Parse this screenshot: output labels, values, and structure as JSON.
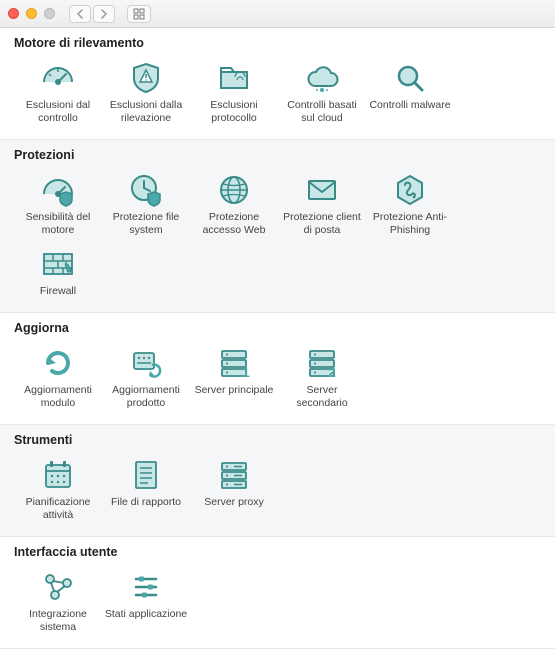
{
  "colors": {
    "teal": "#4aa8a8",
    "stroke": "#3a8a8a",
    "fill": "#c9e6e6"
  },
  "sections": [
    {
      "title": "Motore di rilevamento",
      "alt": false,
      "items": [
        {
          "name": "exclusions-control",
          "label": "Esclusioni dal controllo",
          "icon": "gauge"
        },
        {
          "name": "exclusions-detection",
          "label": "Esclusioni dalla rilevazione",
          "icon": "shield-alert"
        },
        {
          "name": "exclusions-protocol",
          "label": "Esclusioni protocollo",
          "icon": "folder"
        },
        {
          "name": "cloud-controls",
          "label": "Controlli basati sul cloud",
          "icon": "cloud"
        },
        {
          "name": "malware-controls",
          "label": "Controlli malware",
          "icon": "magnifier"
        }
      ]
    },
    {
      "title": "Protezioni",
      "alt": true,
      "items": [
        {
          "name": "engine-sensitivity",
          "label": "Sensibilità del motore",
          "icon": "gauge-badge"
        },
        {
          "name": "fs-protection",
          "label": "Protezione file system",
          "icon": "clock-shield"
        },
        {
          "name": "web-protection",
          "label": "Protezione accesso Web",
          "icon": "globe"
        },
        {
          "name": "mail-protection",
          "label": "Protezione client di posta",
          "icon": "mail"
        },
        {
          "name": "anti-phishing",
          "label": "Protezione Anti-Phishing",
          "icon": "phishing"
        },
        {
          "name": "firewall",
          "label": "Firewall",
          "icon": "firewall"
        }
      ]
    },
    {
      "title": "Aggiorna",
      "alt": false,
      "items": [
        {
          "name": "module-updates",
          "label": "Aggiornamenti modulo",
          "icon": "refresh"
        },
        {
          "name": "product-updates",
          "label": "Aggiornamenti prodotto",
          "icon": "package"
        },
        {
          "name": "primary-server",
          "label": "Server principale",
          "icon": "server-1"
        },
        {
          "name": "secondary-server",
          "label": "Server secondario",
          "icon": "server-2"
        }
      ]
    },
    {
      "title": "Strumenti",
      "alt": true,
      "items": [
        {
          "name": "task-scheduler",
          "label": "Pianificazione attività",
          "icon": "calendar"
        },
        {
          "name": "report-files",
          "label": "File di rapporto",
          "icon": "report"
        },
        {
          "name": "proxy-server",
          "label": "Server proxy",
          "icon": "server"
        }
      ]
    },
    {
      "title": "Interfaccia utente",
      "alt": false,
      "items": [
        {
          "name": "system-integration",
          "label": "Integrazione sistema",
          "icon": "nodes"
        },
        {
          "name": "app-states",
          "label": "Stati applicazione",
          "icon": "sliders"
        }
      ]
    }
  ]
}
